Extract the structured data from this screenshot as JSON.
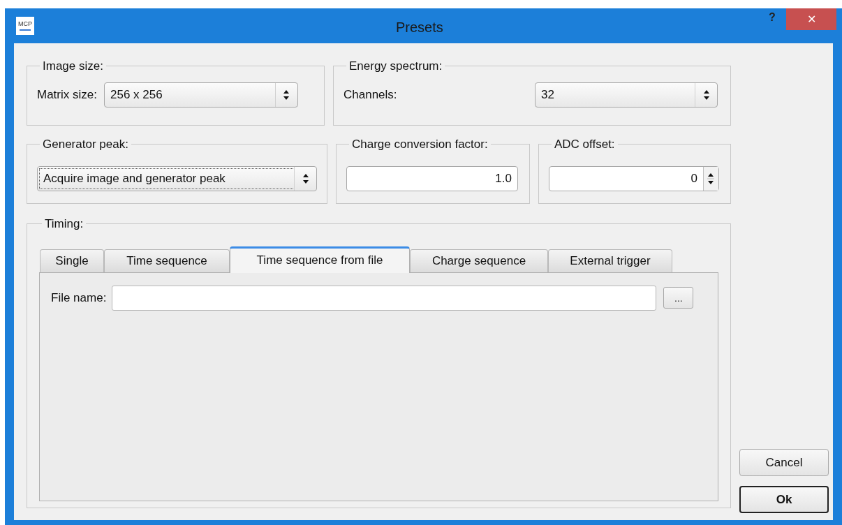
{
  "window": {
    "title": "Presets",
    "app_icon": "MCP",
    "help": "?",
    "close": "✕"
  },
  "groups": [
    {
      "title": "Image size:",
      "control": {
        "kind": "combo",
        "label": "Matrix size:",
        "value": "256 x 256",
        "focused": false
      }
    },
    {
      "title": "Energy spectrum:",
      "control": {
        "kind": "combo",
        "label": "Channels:",
        "value": "32",
        "focused": false
      }
    },
    {
      "title": "Generator peak:",
      "control": {
        "kind": "combo",
        "value": "Acquire image and generator peak",
        "focused": true
      }
    },
    {
      "title": "Charge conversion factor:",
      "control": {
        "kind": "line_edit",
        "value": "1.0",
        "focused": false
      }
    },
    {
      "title": "ADC offset:",
      "control": {
        "kind": "spin",
        "value": "0",
        "focused": false
      }
    }
  ],
  "timing": {
    "title": "Timing:",
    "tabs": [
      {
        "label": "Single",
        "selected": false
      },
      {
        "label": "Time sequence",
        "selected": false
      },
      {
        "label": "Time sequence from file",
        "selected": true
      },
      {
        "label": "Charge sequence",
        "selected": false
      },
      {
        "label": "External trigger",
        "selected": false
      }
    ],
    "file_name": {
      "label": "File name:",
      "browse": "..."
    }
  },
  "buttons": [
    {
      "label": "Cancel",
      "default": false
    },
    {
      "label": "Ok",
      "default": true
    }
  ]
}
